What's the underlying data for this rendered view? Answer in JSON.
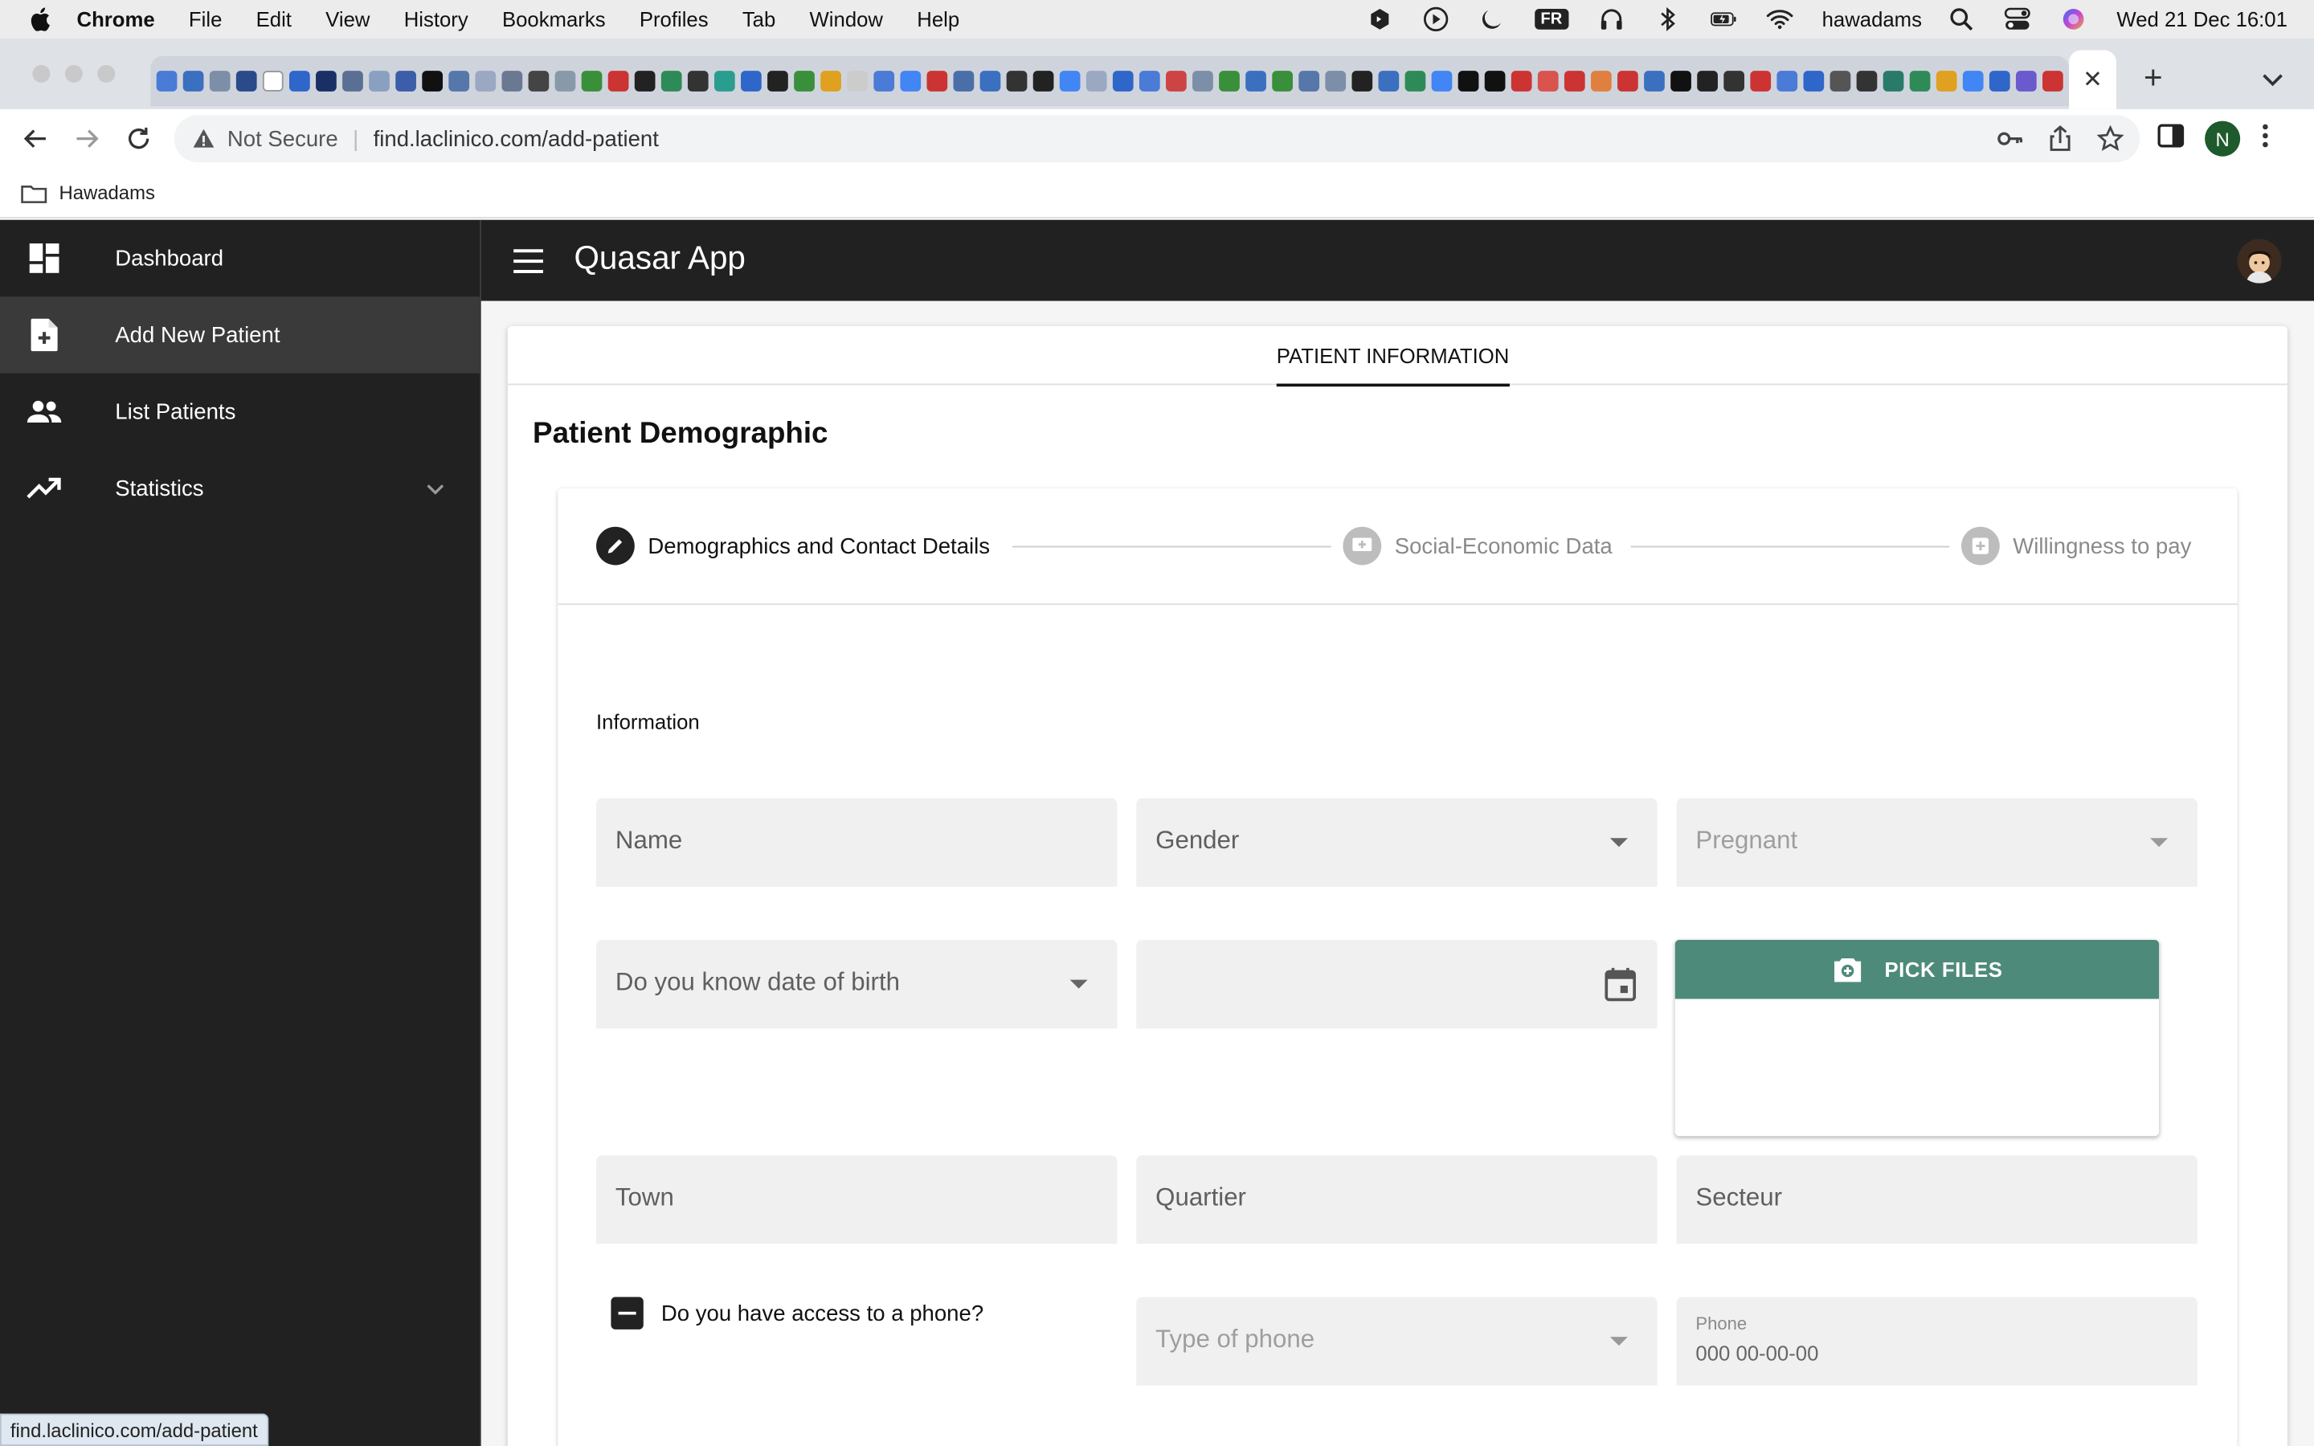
{
  "menubar": {
    "app": "Chrome",
    "items": [
      "File",
      "Edit",
      "View",
      "History",
      "Bookmarks",
      "Profiles",
      "Tab",
      "Window",
      "Help"
    ],
    "input_badge": "FR",
    "user": "hawadams",
    "datetime": "Wed 21 Dec  16:01"
  },
  "browser": {
    "security_label": "Not Secure",
    "url": "find.laclinico.com/add-patient",
    "profile_initial": "N",
    "bookmark_folder": "Hawadams",
    "status_url": "find.laclinico.com/add-patient",
    "tab_icon_colors": [
      "#4a7bd6",
      "#3b6fc0",
      "#7d8ea8",
      "#2a4a8a",
      "#ffffff",
      "#2e66c9",
      "#1a2f66",
      "#5a6f94",
      "#8aa0c0",
      "#3c5ea8",
      "#111111",
      "#5577aa",
      "#9aa8c2",
      "#6a7892",
      "#444444",
      "#8899aa",
      "#3a8f3a",
      "#cc3333",
      "#222222",
      "#2e8b57",
      "#333333",
      "#2a9d8f",
      "#2e66c9",
      "#222222",
      "#3a8f3a",
      "#e0a020",
      "#cccccc",
      "#4a7bd6",
      "#4285f4",
      "#cc3333",
      "#4a6fa8",
      "#3b6fc0",
      "#333333",
      "#222222",
      "#4285f4",
      "#9aa8c2",
      "#2e66c9",
      "#4a7bd6",
      "#cc4444",
      "#7d8ea8",
      "#3a8f3a",
      "#3b6fc0",
      "#3a8f3a",
      "#5577aa",
      "#7d8ea8",
      "#222222",
      "#3b6fc0",
      "#2e8b57",
      "#4285f4",
      "#111111",
      "#111111",
      "#cc3333",
      "#d9534f",
      "#cc3333",
      "#e08040",
      "#cc3333",
      "#3b6fc0",
      "#111111",
      "#222222",
      "#333333",
      "#cc3333",
      "#4a7bd6",
      "#2e66c9",
      "#555555",
      "#333333",
      "#2a7a6a",
      "#2e8b57",
      "#e0a020",
      "#4285f4",
      "#2e66c9",
      "#6a5acd",
      "#cc3333",
      "#3a8f3a",
      "#444444",
      "#e08040"
    ]
  },
  "sidebar": {
    "items": [
      {
        "label": "Dashboard",
        "icon": "dashboard-icon"
      },
      {
        "label": "Add New Patient",
        "icon": "note-add-icon"
      },
      {
        "label": "List Patients",
        "icon": "people-icon"
      },
      {
        "label": "Statistics",
        "icon": "trending-up-icon"
      }
    ]
  },
  "header": {
    "title": "Quasar App"
  },
  "main": {
    "tab_label": "PATIENT INFORMATION",
    "section_title": "Patient Demographic",
    "steps": [
      {
        "label": "Demographics and Contact Details",
        "state": "active"
      },
      {
        "label": "Social-Economic Data",
        "state": "inactive"
      },
      {
        "label": "Willingness to pay",
        "state": "inactive"
      }
    ],
    "info_label": "Information",
    "fields": {
      "name": "Name",
      "gender": "Gender",
      "pregnant": "Pregnant",
      "know_dob": "Do you know date of birth",
      "town": "Town",
      "quartier": "Quartier",
      "secteur": "Secteur",
      "type_of_phone": "Type of phone",
      "phone_label": "Phone",
      "phone_mask": "000 00-00-00"
    },
    "pick_files_label": "PICK FILES",
    "phone_question": "Do you have access to a phone?",
    "colors": {
      "accent": "#4e8a7a",
      "dark": "#212121"
    }
  }
}
